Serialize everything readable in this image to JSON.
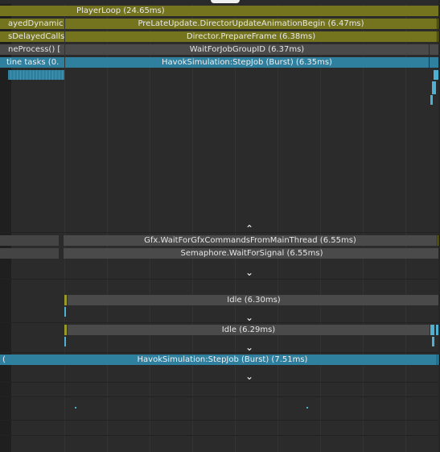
{
  "rows": {
    "player_loop": "PlayerLoop (24.65ms)",
    "delayed_dynamic": "ayedDynamic",
    "pre_late_update": "PreLateUpdate.DirectorUpdateAnimationBegin (6.47ms)",
    "delayed_calls": "sDelayedCalls",
    "prepare_frame": "Director.PrepareFrame (6.38ms)",
    "ne_process": "neProcess() [",
    "wait_job_group": "WaitForJobGroupID (6.37ms)",
    "tine_tasks": "tine tasks (0.",
    "havok_step_1": "HavokSimulation:StepJob (Burst) (6.35ms)",
    "gfx_wait": "Gfx.WaitForGfxCommandsFromMainThread (6.55ms)",
    "semaphore_wait": "Semaphore.WaitForSignal (6.55ms)",
    "idle_1": "Idle (6.30ms)",
    "idle_2": "Idle (6.29ms)",
    "left_paren": "(",
    "havok_step_2": "HavokSimulation:StepJob (Burst) (7.51ms)"
  },
  "colors": {
    "olive": "#74731e",
    "blue": "#2f7f9e",
    "gray": "#4a4a4a",
    "background": "#2b2b2b"
  },
  "icons": {
    "expand_up": "chevron-up-icon",
    "collapse_down": "chevron-down-icon"
  }
}
